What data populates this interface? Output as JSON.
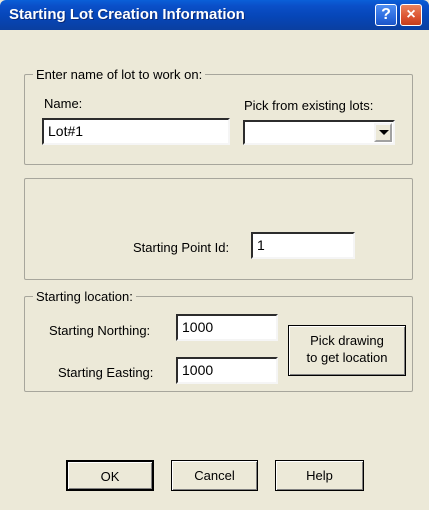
{
  "window": {
    "title": "Starting Lot Creation Information"
  },
  "titlebar_buttons": {
    "help_icon": "?",
    "close_icon": "×"
  },
  "lot_group": {
    "legend": "Enter name of lot to work on:",
    "name_label": "Name:",
    "name_value": "Lot#1",
    "pick_label": "Pick from existing lots:",
    "pick_value": ""
  },
  "point_group": {
    "label": "Starting Point Id:",
    "value": "1"
  },
  "location_group": {
    "legend": "Starting location:",
    "northing_label": "Starting Northing:",
    "northing_value": "1000",
    "easting_label": "Starting Easting:",
    "easting_value": "1000",
    "pick_button_line1": "Pick drawing",
    "pick_button_line2": "to get location"
  },
  "buttons": {
    "ok": "OK",
    "cancel": "Cancel",
    "help": "Help"
  }
}
